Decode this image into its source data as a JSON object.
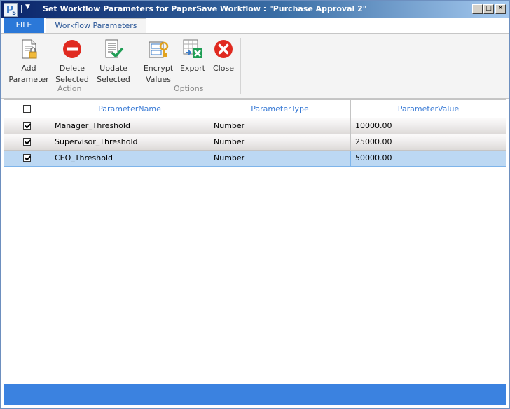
{
  "window": {
    "title": "Set Workflow Parameters for PaperSave Workflow : \"Purchase Approval 2\"",
    "app_icon_letters": [
      "P",
      "S"
    ],
    "controls": {
      "minimize": "_",
      "maximize": "□",
      "close": "✕"
    }
  },
  "tabs": {
    "file": "FILE",
    "workflow_parameters": "Workflow Parameters"
  },
  "ribbon": {
    "action_group": {
      "label": "Action",
      "buttons": [
        {
          "line1": "Add",
          "line2": "Parameter",
          "icon": "add-parameter-icon"
        },
        {
          "line1": "Delete",
          "line2": "Selected",
          "icon": "delete-icon"
        },
        {
          "line1": "Update",
          "line2": "Selected",
          "icon": "update-icon"
        }
      ]
    },
    "options_group": {
      "label": "Options",
      "buttons": [
        {
          "line1": "Encrypt",
          "line2": "Values",
          "icon": "encrypt-icon"
        },
        {
          "line1": "Export",
          "line2": "",
          "icon": "export-excel-icon"
        },
        {
          "line1": "Close",
          "line2": "",
          "icon": "close-icon"
        }
      ]
    }
  },
  "grid": {
    "columns": [
      "ParameterName",
      "ParameterType",
      "ParameterValue"
    ],
    "rows": [
      {
        "checked": true,
        "name": "Manager_Threshold",
        "type": "Number",
        "value": "10000.00"
      },
      {
        "checked": true,
        "name": "Supervisor_Threshold",
        "type": "Number",
        "value": "25000.00"
      },
      {
        "checked": true,
        "name": "CEO_Threshold",
        "type": "Number",
        "value": "50000.00",
        "selected": true
      }
    ]
  },
  "colors": {
    "accent": "#2b78d8",
    "selected_row": "#bcd8f3",
    "header_text": "#3a7bd5",
    "status_bar": "#3b82e0"
  }
}
